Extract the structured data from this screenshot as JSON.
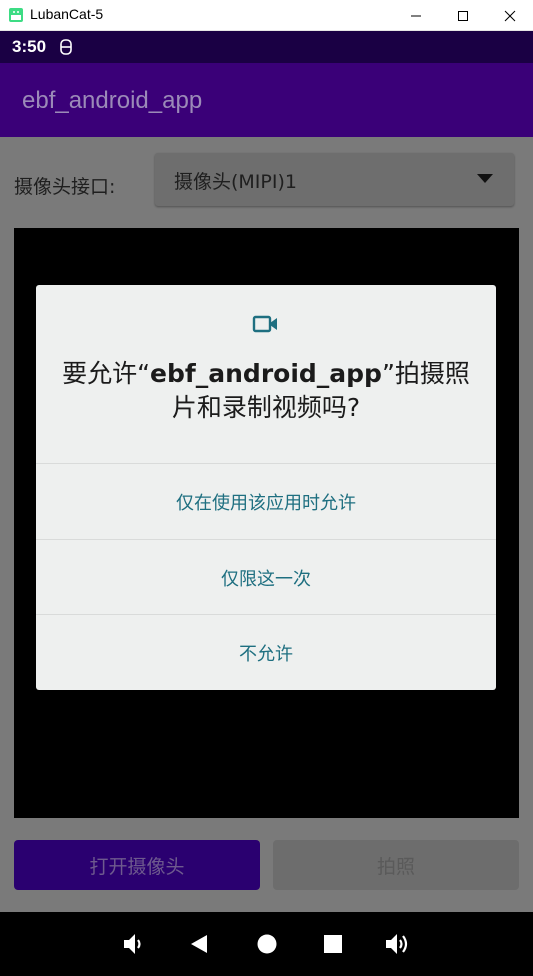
{
  "window": {
    "title": "LubanCat-5"
  },
  "status_bar": {
    "time": "3:50",
    "notification_icon": "usb-icon"
  },
  "app_bar": {
    "title": "ebf_android_app"
  },
  "camera_select": {
    "label": "摄像头接口:",
    "selected": "摄像头(MIPI)1"
  },
  "buttons": {
    "open_camera": "打开摄像头",
    "take_photo": "拍照"
  },
  "dialog": {
    "icon": "videocam-icon",
    "message_prefix": "要允许“",
    "app_name": "ebf_android_app",
    "message_suffix": "”拍摄照片和录制视频吗?",
    "options": [
      "仅在使用该应用时允许",
      "仅限这一次",
      "不允许"
    ]
  },
  "nav_bar": {
    "icons": [
      "volume-down-icon",
      "back-icon",
      "home-icon",
      "recents-icon",
      "volume-up-icon"
    ]
  },
  "colors": {
    "status_bar": "#1a0044",
    "app_bar": "#3a0078",
    "dialog_accent": "#1e6f80"
  }
}
